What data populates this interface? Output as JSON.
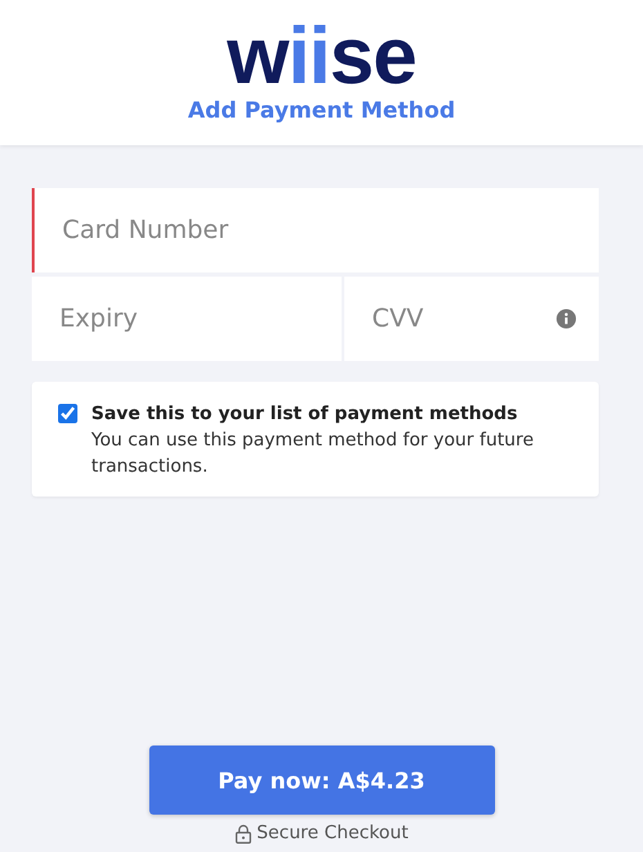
{
  "header": {
    "logo": [
      {
        "text": "w",
        "color": "#101b5c"
      },
      {
        "text": "ii",
        "color": "#4a7ae6"
      },
      {
        "text": "se",
        "color": "#101b5c"
      }
    ],
    "title": "Add Payment Method"
  },
  "card_number": {
    "placeholder": "Card Number",
    "invalid": true
  },
  "expiry": {
    "placeholder": "Expiry"
  },
  "cvv": {
    "placeholder": "CVV"
  },
  "save_option": {
    "checked": true,
    "label": "Save this to your list of payment methods",
    "description": "You can use this payment method for your future transactions."
  },
  "pay_button": "Pay now: A$4.23",
  "secure_note": "Secure Checkout"
}
